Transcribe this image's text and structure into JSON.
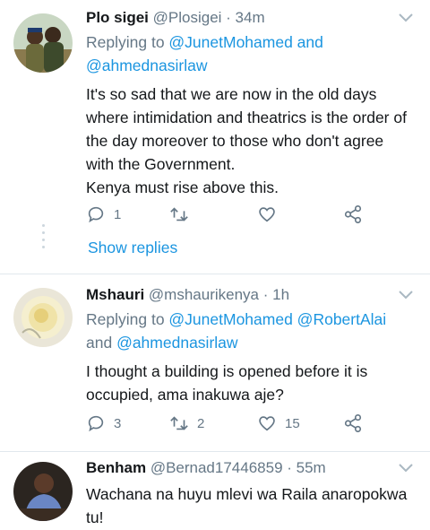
{
  "tweets": [
    {
      "name": "Plo sigei",
      "handle": "@Plosigei · 34m",
      "replying_prefix": "Replying to ",
      "replying_line1": "@JunetMohamed and",
      "replying_line2": "@ahmednasirlaw",
      "body": "It's so sad that we are now in the old days\nwhere intimidation and theatrics is the order of\nthe day moreover to those who don't agree\nwith the Government.\nKenya must rise above this.",
      "reply_count": "1",
      "retweet_count": "",
      "like_count": "",
      "show_replies": "Show replies"
    },
    {
      "name": "Mshauri",
      "handle": "@mshaurikenya · 1h",
      "replying_prefix": "Replying to ",
      "replying_line1": "@JunetMohamed @RobertAlai",
      "replying_line2_prefix": "and ",
      "replying_line2": "@ahmednasirlaw",
      "body": "I thought a building is opened before it is\noccupied, ama inakuwa aje?",
      "reply_count": "3",
      "retweet_count": "2",
      "like_count": "15"
    },
    {
      "name": "Benham",
      "handle": "@Bernad17446859 · 55m",
      "body": "Wachana na huyu mlevi wa Raila anaropokwa\ntu!"
    }
  ],
  "icons": {
    "reply": "reply-icon",
    "retweet": "retweet-icon",
    "like": "heart-icon",
    "share": "share-icon",
    "menu": "chevron-down-icon"
  },
  "colors": {
    "link": "#1b95e0",
    "muted": "#657786",
    "text": "#14171a",
    "divider": "#e1e8ed"
  }
}
